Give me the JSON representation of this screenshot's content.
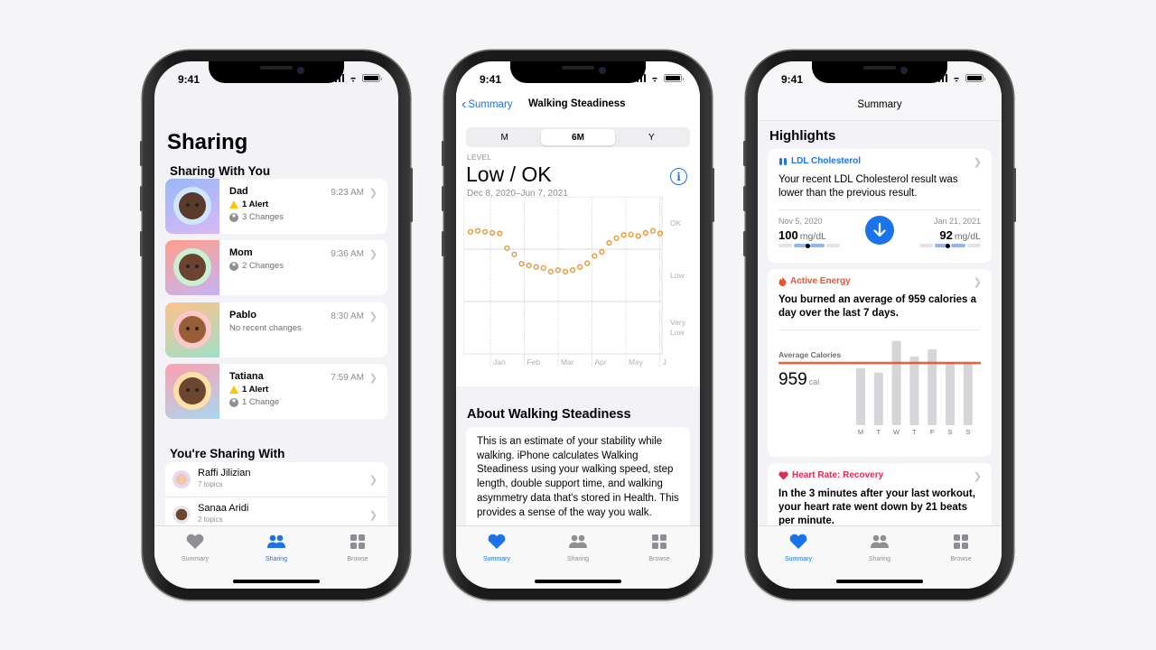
{
  "status_bar": {
    "time": "9:41"
  },
  "tab_bar": {
    "tabs": [
      {
        "label": "Summary",
        "icon": "heart-icon"
      },
      {
        "label": "Sharing",
        "icon": "people-icon"
      },
      {
        "label": "Browse",
        "icon": "grid-icon"
      }
    ]
  },
  "sharing_screen": {
    "title": "Sharing",
    "section_with_you": "Sharing With You",
    "people": [
      {
        "name": "Dad",
        "time": "9:23 AM",
        "alert": "1 Alert",
        "changes": "3 Changes",
        "tile": [
          "#9ab8f7",
          "#d9b8f5"
        ],
        "ring": "#cfe6ff",
        "skin": "#5a3a2a"
      },
      {
        "name": "Mom",
        "time": "9:36 AM",
        "alert": null,
        "changes": "2 Changes",
        "tile": [
          "#ff9f8a",
          "#c6b3f5"
        ],
        "ring": "#c9f0d2",
        "skin": "#6b4431"
      },
      {
        "name": "Pablo",
        "time": "8:30 AM",
        "alert": null,
        "changes": "No recent changes",
        "tile": [
          "#ffc28a",
          "#9ee0c8"
        ],
        "ring": "#ffc8c8",
        "skin": "#9a5d3a"
      },
      {
        "name": "Tatiana",
        "time": "7:59 AM",
        "alert": "1 Alert",
        "changes": "1 Change",
        "tile": [
          "#ff9fb0",
          "#a8d8f0"
        ],
        "ring": "#ffe1a8",
        "skin": "#6d4630"
      }
    ],
    "section_youre_sharing": "You're Sharing With",
    "sharing_with": [
      {
        "name": "Raffi Jilizian",
        "topics": "7 topics",
        "ring": "#e7d8f5",
        "skin": "#f0c8a8"
      },
      {
        "name": "Sanaa Aridi",
        "topics": "2 topics",
        "ring": "#e8e8e8",
        "skin": "#6d4630"
      }
    ],
    "active_tab": 1
  },
  "walking_screen": {
    "back_label": "Summary",
    "title": "Walking Steadiness",
    "segments": [
      "M",
      "6M",
      "Y"
    ],
    "selected_segment": "6M",
    "level_caption": "LEVEL",
    "level_value": "Low / OK",
    "date_range": "Dec 8, 2020–Jun 7, 2021",
    "about_title": "About Walking Steadiness",
    "about_text": "This is an estimate of your stability while walking. iPhone calculates Walking Steadiness using your walking speed, step length, double support time, and walking asymmetry data that's stored in Health. This provides a sense of the way you walk.",
    "active_tab": 0
  },
  "summary_screen": {
    "title": "Summary",
    "highlights_title": "Highlights",
    "ldl": {
      "category": "LDL Cholesterol",
      "color": "#1a73e8",
      "message": "Your recent LDL Cholesterol result was lower than the previous result.",
      "previous": {
        "date": "Nov 5, 2020",
        "value": "100",
        "unit": "mg/dL"
      },
      "current": {
        "date": "Jan 21, 2021",
        "value": "92",
        "unit": "mg/dL"
      }
    },
    "active_energy": {
      "category": "Active Energy",
      "color": "#f0522b",
      "message": "You burned an average of 959 calories a day over the last 7 days.",
      "avg_label": "Average Calories",
      "avg_value": "959",
      "avg_unit": "cal"
    },
    "heart_rate": {
      "category": "Heart Rate: Recovery",
      "color": "#e8264f",
      "message": "In the 3 minutes after your last workout, your heart rate went down by 21 beats per minute."
    },
    "active_tab": 0
  },
  "chart_data": [
    {
      "type": "scatter",
      "title": "Walking Steadiness",
      "x_labels": [
        "Jan",
        "Feb",
        "Mar",
        "Apr",
        "May",
        "J"
      ],
      "y_bands": [
        "OK",
        "Low",
        "Very Low"
      ],
      "ylim": [
        0,
        3
      ],
      "y_note": "level: 0=bottom of Very Low, 1=Very Low/Low boundary, 2=Low/OK boundary, 3=top of OK",
      "values": [
        2.33,
        2.35,
        2.33,
        2.31,
        2.3,
        2.02,
        1.9,
        1.72,
        1.69,
        1.66,
        1.64,
        1.57,
        1.6,
        1.57,
        1.6,
        1.66,
        1.73,
        1.87,
        1.95,
        2.12,
        2.21,
        2.27,
        2.28,
        2.25,
        2.31,
        2.35,
        2.3
      ],
      "color": "#e8962e",
      "grid": true
    },
    {
      "type": "bar",
      "title": "Average Calories",
      "categories": [
        "M",
        "T",
        "W",
        "T",
        "F",
        "S",
        "S"
      ],
      "values": [
        880,
        810,
        1300,
        1060,
        1170,
        970,
        960
      ],
      "average": 959,
      "ylim": [
        0,
        1350
      ],
      "bar_color": "#d6d6da",
      "average_line_color": "#e8502a"
    }
  ]
}
